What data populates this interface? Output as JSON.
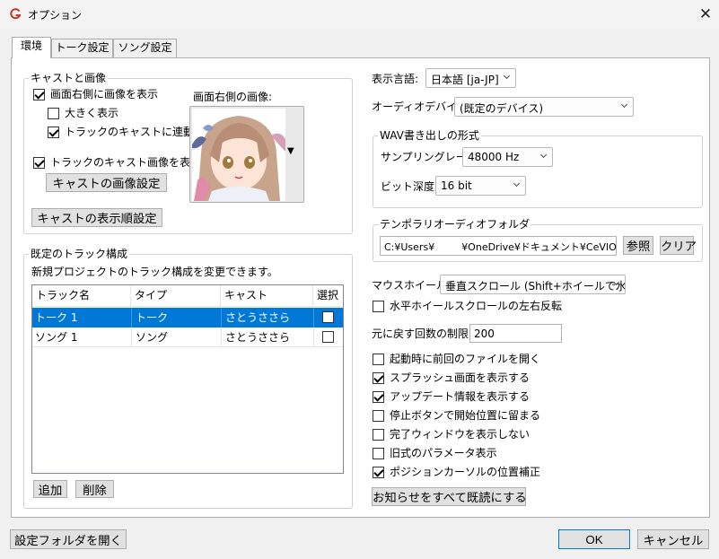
{
  "window": {
    "title": "オプション",
    "close_glyph": "✕"
  },
  "tabs": [
    "環境",
    "トーク設定",
    "ソング設定"
  ],
  "cast_image": {
    "group_title": "キャストと画像",
    "show_image_right": {
      "label": "画面右側に画像を表示",
      "checked": true
    },
    "show_large": {
      "label": "大きく表示",
      "checked": false
    },
    "link_track_cast": {
      "label": "トラックのキャストに連動",
      "checked": true
    },
    "show_track_cast_image": {
      "label": "トラックのキャスト画像を表示",
      "checked": true
    },
    "cast_image_settings_button": "キャストの画像設定",
    "right_image_label": "画面右側の画像:",
    "dropdown_glyph": "▼",
    "cast_order_button": "キャストの表示順設定"
  },
  "default_tracks": {
    "group_title": "既定のトラック構成",
    "description": "新規プロジェクトのトラック構成を変更できます。",
    "columns": [
      "トラック名",
      "タイプ",
      "キャスト",
      "選択"
    ],
    "rows": [
      {
        "name": "トーク 1",
        "type": "トーク",
        "cast": "さとうささら",
        "selected": false
      },
      {
        "name": "ソング 1",
        "type": "ソング",
        "cast": "さとうささら",
        "selected": false
      }
    ],
    "add_button": "追加",
    "delete_button": "削除"
  },
  "right": {
    "display_language_label": "表示言語:",
    "display_language_value": "日本語 [ja-JP]",
    "audio_device_label": "オーディオデバイス:",
    "audio_device_value": "(既定のデバイス)",
    "wav_group_title": "WAV書き出しの形式",
    "sampling_rate_label": "サンプリングレート:",
    "sampling_rate_value": "48000 Hz",
    "bit_depth_label": "ビット深度:",
    "bit_depth_value": "16 bit",
    "temp_folder_group_title": "テンポラリオーディオフォルダ",
    "temp_folder_path": "C:¥Users¥",
    "temp_folder_path_rest": "¥OneDrive¥ドキュメント¥CeVIO¥Ai",
    "browse_button": "参照",
    "clear_button": "クリア",
    "mouse_wheel_label": "マウスホイール:",
    "mouse_wheel_value": "垂直スクロール (Shift+ホイールで水平)",
    "hscroll_invert": {
      "label": "水平ホイールスクロールの左右反転",
      "checked": false
    },
    "undo_limit_label": "元に戻す回数の制限:",
    "undo_limit_value": "200",
    "options": [
      {
        "label": "起動時に前回のファイルを開く",
        "checked": false
      },
      {
        "label": "スプラッシュ画面を表示する",
        "checked": true
      },
      {
        "label": "アップデート情報を表示する",
        "checked": true
      },
      {
        "label": "停止ボタンで開始位置に留まる",
        "checked": false
      },
      {
        "label": "完了ウィンドウを表示しない",
        "checked": false
      },
      {
        "label": "旧式のパラメータ表示",
        "checked": false
      },
      {
        "label": "ポジションカーソルの位置補正",
        "checked": true
      }
    ],
    "mark_all_read_button": "お知らせをすべて既読にする"
  },
  "footer": {
    "open_settings_folder_button": "設定フォルダを開く",
    "ok_button": "OK",
    "cancel_button": "キャンセル"
  },
  "colors": {
    "accent": "#0078d7",
    "selection": "#0078d7"
  }
}
